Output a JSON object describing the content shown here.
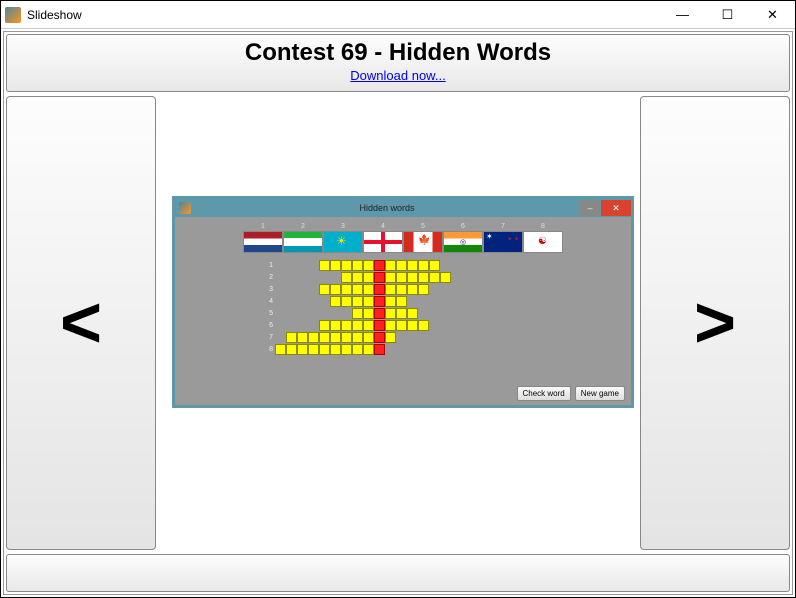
{
  "window": {
    "title": "Slideshow",
    "minimize": "—",
    "maximize": "☐",
    "close": "✕"
  },
  "header": {
    "title": "Contest 69 - Hidden Words",
    "link": "Download now..."
  },
  "nav": {
    "prev": "<",
    "next": ">"
  },
  "inner": {
    "title": "Hidden words",
    "minimize": "–",
    "close": "✕",
    "flags": [
      {
        "num": "1",
        "cls": "flag-nl"
      },
      {
        "num": "2",
        "cls": "flag-uz"
      },
      {
        "num": "3",
        "cls": "flag-kz"
      },
      {
        "num": "4",
        "cls": "flag-ge"
      },
      {
        "num": "5",
        "cls": "flag-ca"
      },
      {
        "num": "6",
        "cls": "flag-in"
      },
      {
        "num": "7",
        "cls": "flag-nz"
      },
      {
        "num": "8",
        "cls": "flag-kr"
      }
    ],
    "rows": [
      {
        "num": "1",
        "pre": 4,
        "len": 11,
        "red": 5
      },
      {
        "num": "2",
        "pre": 6,
        "len": 10,
        "red": 3
      },
      {
        "num": "3",
        "pre": 4,
        "len": 10,
        "red": 5
      },
      {
        "num": "4",
        "pre": 5,
        "len": 7,
        "red": 4
      },
      {
        "num": "5",
        "pre": 7,
        "len": 6,
        "red": 2
      },
      {
        "num": "6",
        "pre": 4,
        "len": 10,
        "red": 5
      },
      {
        "num": "7",
        "pre": 1,
        "len": 10,
        "red": 8
      },
      {
        "num": "8",
        "pre": 0,
        "len": 10,
        "red": 9
      }
    ],
    "buttons": {
      "check": "Check word",
      "newgame": "New game"
    }
  }
}
